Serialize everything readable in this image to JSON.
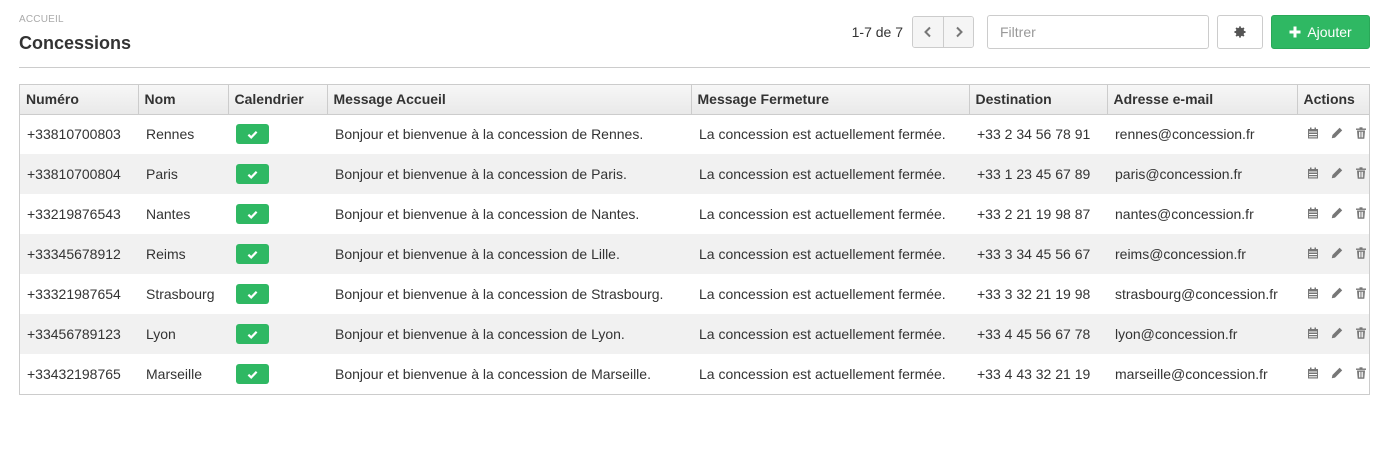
{
  "header": {
    "breadcrumb": "ACCUEIL",
    "title": "Concessions"
  },
  "toolbar": {
    "pager_text": "1-7 de 7",
    "filter_placeholder": "Filtrer",
    "add_label": "Ajouter"
  },
  "colors": {
    "accent_green": "#2fb863",
    "row_alt": "#f1f1f1",
    "icon_gray": "#777777"
  },
  "icons": {
    "prev": "chevron-left-icon",
    "next": "chevron-right-icon",
    "settings": "gear-icon",
    "add": "plus-icon",
    "calendar_status": "check-icon",
    "row_actions": [
      "calendar-icon",
      "pencil-icon",
      "trash-icon"
    ]
  },
  "table": {
    "columns": [
      "Numéro",
      "Nom",
      "Calendrier",
      "Message Accueil",
      "Message Fermeture",
      "Destination",
      "Adresse e-mail",
      "Actions"
    ],
    "rows": [
      {
        "numero": "+33810700803",
        "nom": "Rennes",
        "calendrier": true,
        "accueil": "Bonjour et bienvenue à la concession de Rennes.",
        "fermeture": "La concession est actuellement fermée.",
        "destination": "+33 2 34 56 78 91",
        "email": "rennes@concession.fr"
      },
      {
        "numero": "+33810700804",
        "nom": "Paris",
        "calendrier": true,
        "accueil": "Bonjour et bienvenue à la concession de Paris.",
        "fermeture": "La concession est actuellement fermée.",
        "destination": "+33 1 23 45 67 89",
        "email": "paris@concession.fr"
      },
      {
        "numero": "+33219876543",
        "nom": "Nantes",
        "calendrier": true,
        "accueil": "Bonjour et bienvenue à la concession de Nantes.",
        "fermeture": "La concession est actuellement fermée.",
        "destination": "+33 2 21 19 98 87",
        "email": "nantes@concession.fr"
      },
      {
        "numero": "+33345678912",
        "nom": "Reims",
        "calendrier": true,
        "accueil": "Bonjour et bienvenue à la concession de Lille.",
        "fermeture": "La concession est actuellement fermée.",
        "destination": "+33 3 34 45 56 67",
        "email": "reims@concession.fr"
      },
      {
        "numero": "+33321987654",
        "nom": "Strasbourg",
        "calendrier": true,
        "accueil": "Bonjour et bienvenue à la concession de Strasbourg.",
        "fermeture": "La concession est actuellement fermée.",
        "destination": "+33 3 32 21 19 98",
        "email": "strasbourg@concession.fr"
      },
      {
        "numero": "+33456789123",
        "nom": "Lyon",
        "calendrier": true,
        "accueil": "Bonjour et bienvenue à la concession de Lyon.",
        "fermeture": "La concession est actuellement fermée.",
        "destination": "+33 4 45 56 67 78",
        "email": "lyon@concession.fr"
      },
      {
        "numero": "+33432198765",
        "nom": "Marseille",
        "calendrier": true,
        "accueil": "Bonjour et bienvenue à la concession de Marseille.",
        "fermeture": "La concession est actuellement fermée.",
        "destination": "+33 4 43 32 21 19",
        "email": "marseille@concession.fr"
      }
    ]
  }
}
